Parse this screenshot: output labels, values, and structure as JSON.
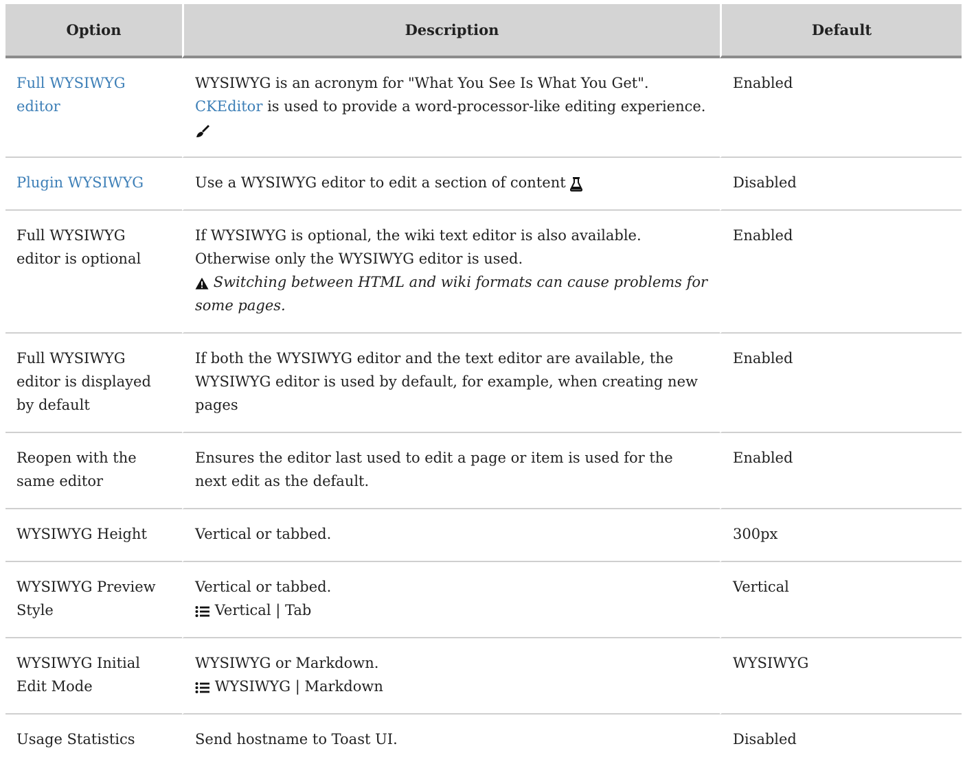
{
  "table": {
    "headers": {
      "option": "Option",
      "description": "Description",
      "default": "Default"
    },
    "rows": [
      {
        "option": "Full WYSIWYG editor",
        "desc_lines": [
          "WYSIWYG is an acronym for \"What You See Is What You Get\".",
          "is used to provide a word-processor-like editing experience."
        ],
        "desc_link": "CKEditor",
        "icon": "paintbrush-icon",
        "default": "Enabled"
      },
      {
        "option": "Plugin WYSIWYG",
        "desc": "Use a WYSIWYG editor to edit a section of content",
        "icon": "flask-icon",
        "default": "Disabled"
      },
      {
        "option": "Full WYSIWYG editor is optional",
        "desc_lines": [
          "If WYSIWYG is optional, the wiki text editor is also available.",
          "Otherwise only the WYSIWYG editor is used."
        ],
        "warning": "Switching between HTML and wiki formats can cause problems for some pages.",
        "icon": "warning-icon",
        "default": "Enabled"
      },
      {
        "option": "Full WYSIWYG editor is displayed by default",
        "desc": "If both the WYSIWYG editor and the text editor are available, the WYSIWYG editor is used by default, for example, when creating new pages",
        "default": "Enabled"
      },
      {
        "option": "Reopen with the same editor",
        "desc": "Ensures the editor last used to edit a page or item is used for the next edit as the default.",
        "default": "Enabled"
      },
      {
        "option": "WYSIWYG Height",
        "desc": "Vertical or tabbed.",
        "default": "300px"
      },
      {
        "option": "WYSIWYG Preview Style",
        "desc": "Vertical or tabbed.",
        "options_list": "Vertical | Tab",
        "icon": "list-icon",
        "default": "Vertical"
      },
      {
        "option": "WYSIWYG Initial Edit Mode",
        "desc": "WYSIWYG or Markdown.",
        "options_list": "WYSIWYG | Markdown",
        "icon": "list-icon",
        "default": "WYSIWYG"
      },
      {
        "option": "Usage Statistics",
        "desc": "Send hostname to Toast UI.",
        "default": "Disabled"
      }
    ]
  },
  "colors": {
    "link": "#3d7fb7",
    "header_bg": "#d4d4d4",
    "header_rule": "#8c8c8c",
    "row_rule": "#cfcfcf",
    "text": "#222222"
  }
}
